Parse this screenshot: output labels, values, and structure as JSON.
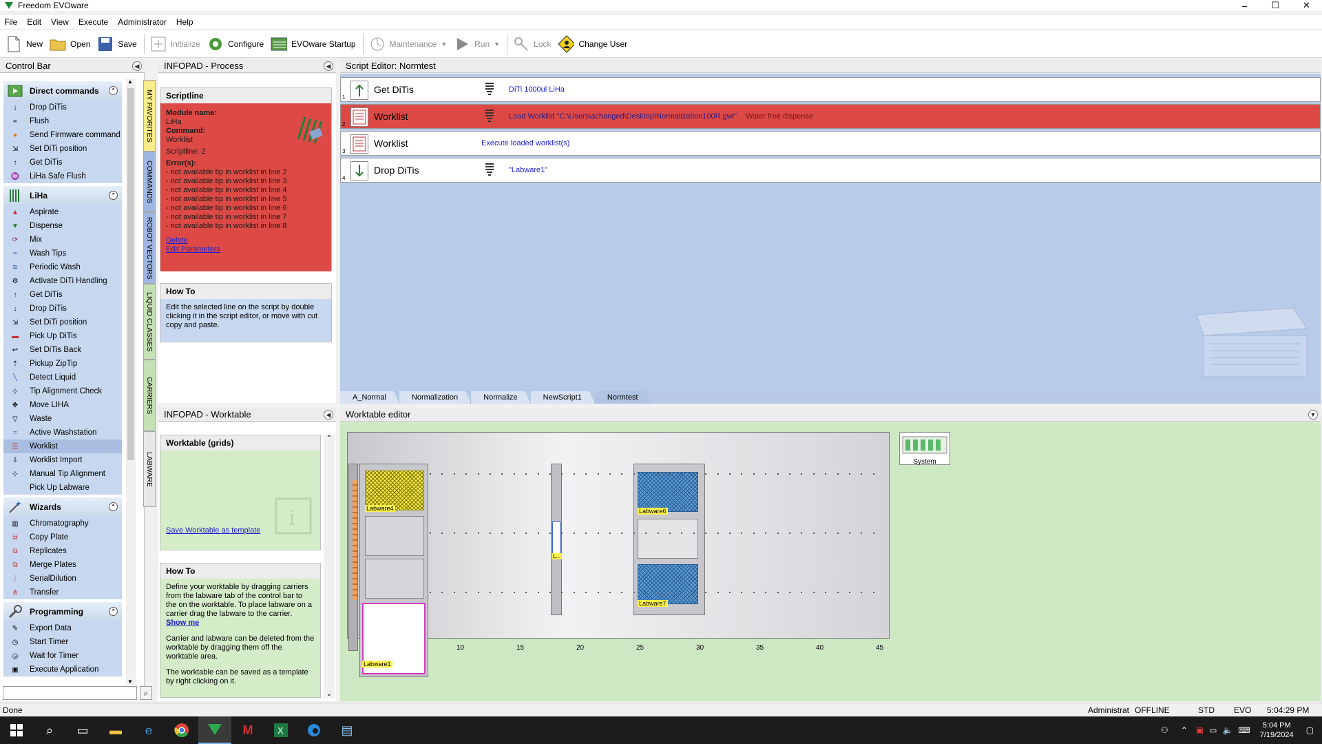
{
  "window": {
    "title": "Freedom EVOware",
    "min": "–",
    "max": "☐",
    "close": "✕"
  },
  "menu": [
    "File",
    "Edit",
    "View",
    "Execute",
    "Administrator",
    "Help"
  ],
  "toolbar": {
    "new": "New",
    "open": "Open",
    "save": "Save",
    "initialize": "Initialize",
    "configure": "Configure",
    "startup": "EVOware Startup",
    "maintenance": "Maintenance",
    "run": "Run",
    "lock": "Lock",
    "change_user": "Change User"
  },
  "controlbar": {
    "title": "Control Bar",
    "groups": [
      {
        "name": "Direct commands",
        "items": [
          "Drop DiTis",
          "Flush",
          "Send Firmware command",
          "Set DiTi position",
          "Get DiTis",
          "LiHa Safe Flush"
        ]
      },
      {
        "name": "LiHa",
        "items": [
          "Aspirate",
          "Dispense",
          "Mix",
          "Wash Tips",
          "Periodic Wash",
          "Activate DiTi Handling",
          "Get DiTis",
          "Drop DiTis",
          "Set DiTi position",
          "Pick Up DiTis",
          "Set DiTis Back",
          "Pickup ZipTip",
          "Detect Liquid",
          "Tip Alignment Check",
          "Move LIHA",
          "Waste",
          "Active Washstation",
          "Worklist",
          "Worklist Import",
          "Manual Tip Alignment",
          "Pick Up Labware"
        ]
      },
      {
        "name": "Wizards",
        "items": [
          "Chromatography",
          "Copy Plate",
          "Replicates",
          "Merge Plates",
          "SerialDilution",
          "Transfer"
        ]
      },
      {
        "name": "Programming",
        "items": [
          "Export Data",
          "Start Timer",
          "Wait for Timer",
          "Execute Application"
        ]
      }
    ]
  },
  "vtabs": [
    "MY FAVORITES",
    "COMMANDS",
    "ROBOT VECTORS",
    "LIQUID CLASSES",
    "CARRIERS",
    "LABWARE"
  ],
  "infopad_process": {
    "title": "INFOPAD - Process",
    "scriptline_title": "Scriptline",
    "module_label": "Module name:",
    "module_value": "LiHa",
    "command_label": "Command:",
    "command_value": "Worklist",
    "scriptline": "Scriptline: 2",
    "errors_label": "Error(s):",
    "errors": [
      "- not available tip in worklist in line 2",
      "- not available tip in worklist in line 3",
      "- not available tip in worklist in line 4",
      "- not available tip in worklist in line 5",
      "- not available tip in worklist in line 6",
      "- not available tip in worklist in line 7",
      "- not available tip in worklist in line 8"
    ],
    "delete": "Delete",
    "edit_params": "Edit Parameters",
    "howto_title": "How To",
    "howto_text": "Edit the selected line on the script by double clicking it in the script editor, or move with cut copy and paste."
  },
  "script_editor": {
    "title": "Script Editor: Normtest",
    "rows": [
      {
        "num": "1",
        "cmd": "Get DiTis",
        "desc": "DiTi 1000ul LiHa",
        "desc2": ""
      },
      {
        "num": "2",
        "cmd": "Worklist",
        "desc": "Load Worklist  \"C:\\Users\\achanged\\Desktop\\Normalization100R.gwl\"",
        "desc2": "Water free dispense"
      },
      {
        "num": "3",
        "cmd": "Worklist",
        "desc": "Execute loaded worklist(s)",
        "desc2": ""
      },
      {
        "num": "4",
        "cmd": "Drop DiTis",
        "desc": "\"Labware1\"",
        "desc2": ""
      }
    ],
    "tabs": [
      "A_Normal",
      "Normalization",
      "Normalize",
      "NewScript1",
      "Normtest"
    ]
  },
  "infopad_worktable": {
    "title": "INFOPAD - Worktable",
    "grids_title": "Worktable (grids)",
    "save_template": "Save Worktable as template",
    "howto_title": "How To",
    "howto_p1": "Define your worktable by dragging carriers from the labware tab of the control bar to the on the worktable. To place labware on a carrier drag the labware to the carrier.",
    "show_me": "Show me",
    "howto_p2": "Carrier and labware can be deleted from the worktable by dragging them off the worktable area.",
    "howto_p3": "The worktable can be saved as a template by right clicking on it."
  },
  "worktable_editor": {
    "title": "Worktable editor",
    "grid_labels": [
      "10",
      "15",
      "20",
      "25",
      "30",
      "35",
      "40",
      "45"
    ],
    "labware": {
      "lw4": "Labware4",
      "lw6": "Labware6",
      "lw7": "Labware7",
      "lw1": "Labware1",
      "small": "L..."
    },
    "system": "System"
  },
  "statusbar": {
    "left": "Done",
    "user": "Administrat",
    "mode": "OFFLINE",
    "std": "STD",
    "evo": "EVO",
    "time": "5:04:29 PM"
  },
  "taskbar": {
    "time": "5:04 PM",
    "date": "7/19/2024"
  },
  "colors": {
    "error_red": "#dd4a45",
    "script_bg": "#b8cbe9",
    "worktable_bg": "#cfe8c4",
    "item_blue": "#c6d7ef"
  }
}
